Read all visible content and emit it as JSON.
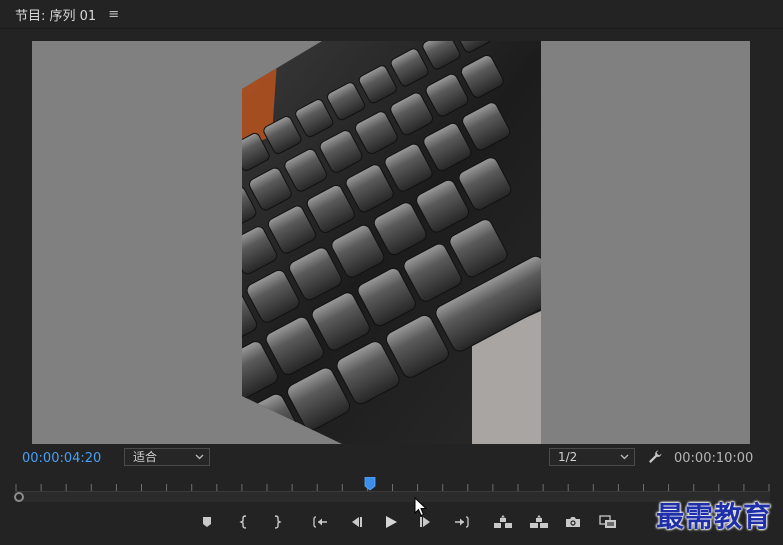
{
  "panel": {
    "title": "节目: 序列 01",
    "menu_glyph": "≡"
  },
  "playback": {
    "current_timecode": "00:00:04:20",
    "fit_label": "适合",
    "resolution_label": "1/2",
    "duration_timecode": "00:00:10:00",
    "playhead_position": 0.47
  },
  "colors": {
    "timecode_accent": "#4a9ff5",
    "viewer_background": "#808080",
    "panel_background": "#232323"
  },
  "transport_icons": [
    "add-marker-icon",
    "mark-in-icon",
    "mark-out-icon",
    "go-to-in-icon",
    "step-back-icon",
    "play-icon",
    "step-forward-icon",
    "go-to-out-icon",
    "lift-icon",
    "extract-icon",
    "export-frame-icon",
    "comparison-view-icon"
  ],
  "watermark": {
    "text": "最需教育"
  }
}
